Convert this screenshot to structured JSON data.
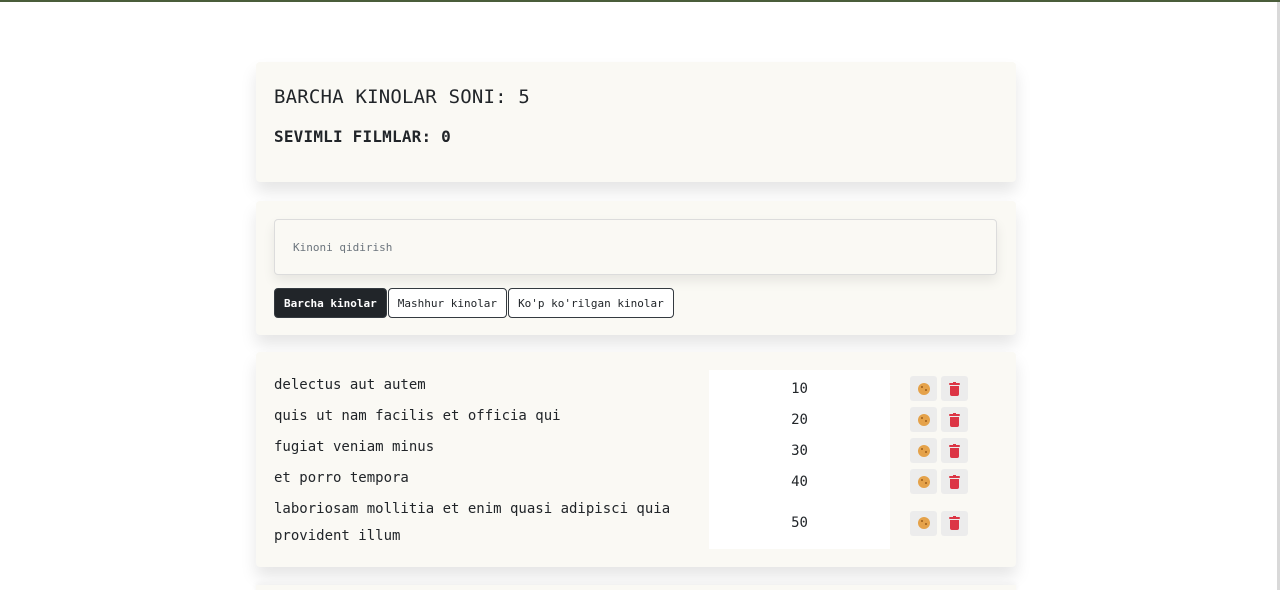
{
  "info": {
    "all_movies": "BARCHA KINOLAR SONI: 5",
    "favorites": "SEVIMLI FILMLAR: 0"
  },
  "search": {
    "placeholder": "Kinoni qidirish",
    "value": ""
  },
  "filters": [
    {
      "label": "Barcha kinolar",
      "active": true
    },
    {
      "label": "Mashhur kinolar",
      "active": false
    },
    {
      "label": "Ko'p ko'rilgan kinolar",
      "active": false
    }
  ],
  "movies": [
    {
      "name": "delectus aut autem",
      "views": "10"
    },
    {
      "name": "quis ut nam facilis et officia qui",
      "views": "20"
    },
    {
      "name": "fugiat veniam minus",
      "views": "30"
    },
    {
      "name": "et porro tempora",
      "views": "40"
    },
    {
      "name": "laboriosam mollitia et enim quasi adipisci quia provident illum",
      "views": "50"
    }
  ],
  "icons": {
    "like": "cookie-icon",
    "delete": "trash-icon"
  },
  "colors": {
    "card_bg": "#faf9f4",
    "active_button": "#212529",
    "delete": "#dc3545",
    "like": "#e5a24a"
  }
}
